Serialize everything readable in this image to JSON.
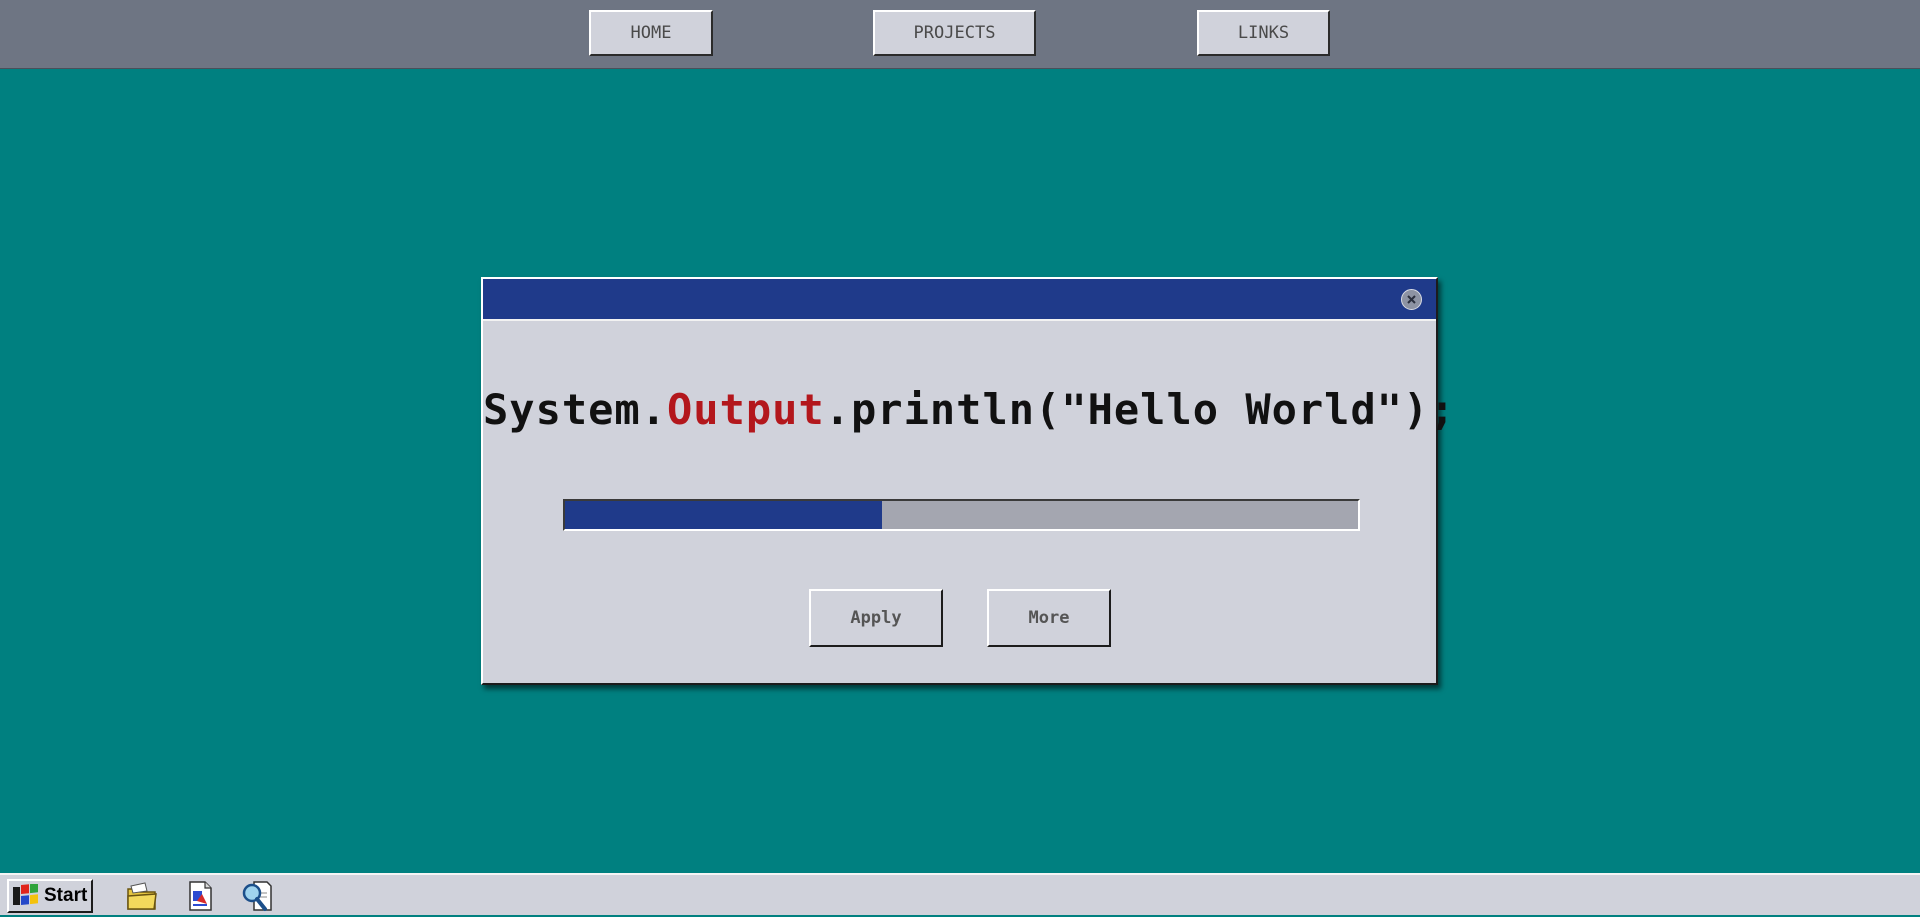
{
  "nav": {
    "home_label": "HOME",
    "projects_label": "PROJECTS",
    "links_label": "LINKS"
  },
  "dialog": {
    "title": "",
    "code": {
      "prefix": "System.",
      "highlight": "Output",
      "suffix": ".println(\"Hello World\");"
    },
    "progress": 0.4,
    "apply_label": "Apply",
    "more_label": "More"
  },
  "taskbar": {
    "start_label": "Start",
    "icons": [
      "folder-icon",
      "document-icon",
      "search-icon"
    ]
  },
  "colors": {
    "desktop": "#008080",
    "titlebar": "#1f3a8a",
    "highlight": "#b3171c",
    "window": "#d0d2db",
    "topbar": "#6e7583"
  }
}
